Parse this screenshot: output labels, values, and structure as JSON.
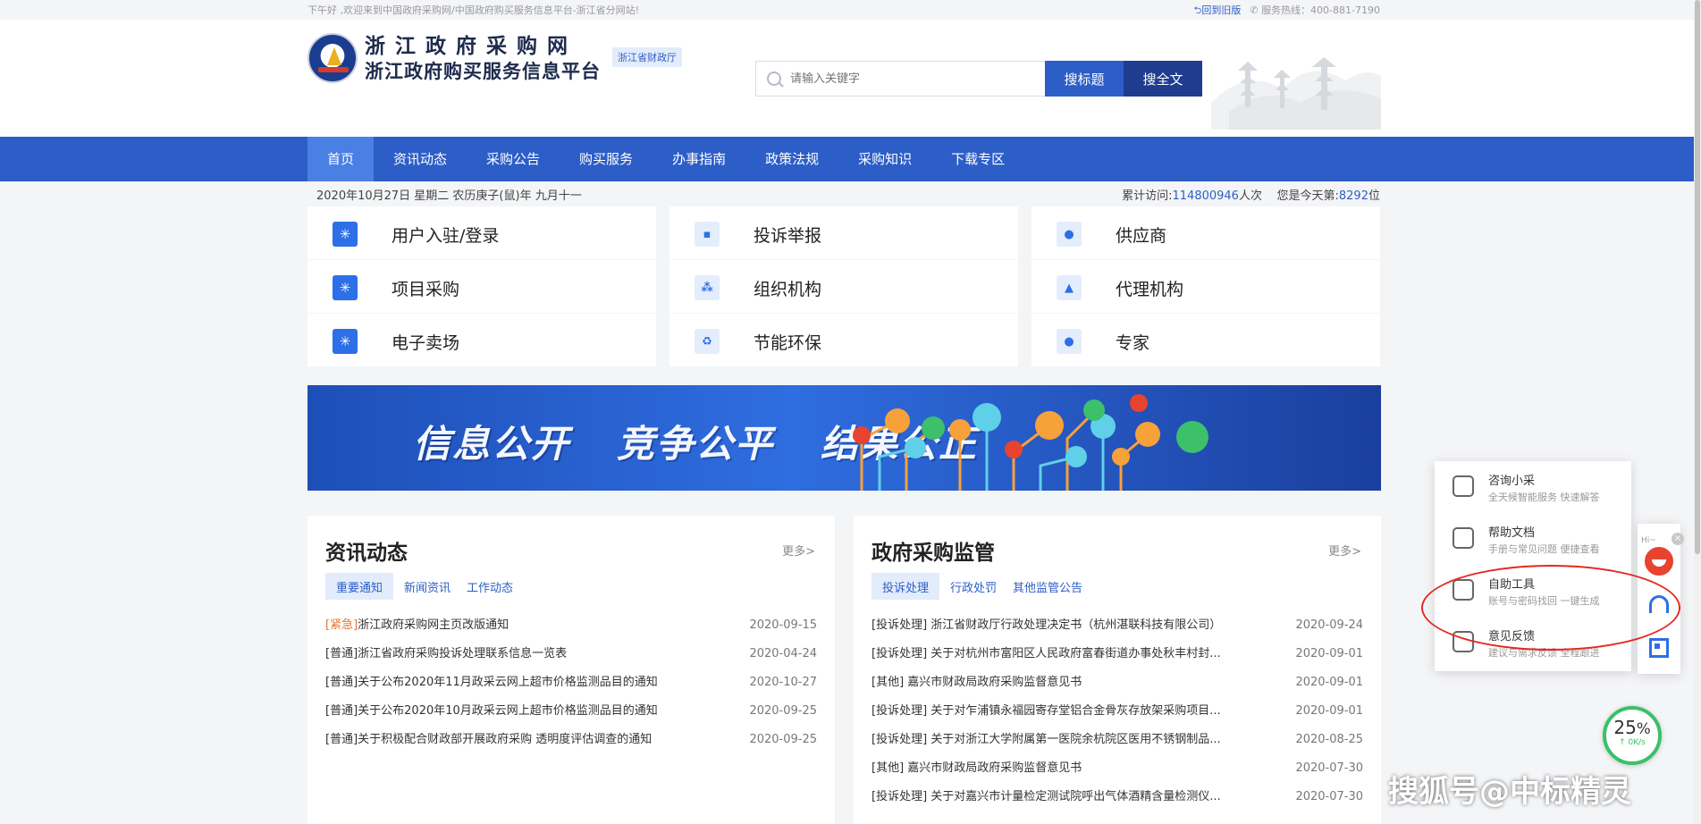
{
  "topbar": {
    "welcome": "下午好 ,欢迎来到中国政府采购网/中国政府购买服务信息平台-浙江省分网站!",
    "back_old": "回到旧版",
    "hotline": "服务热线：400-881-7190"
  },
  "header": {
    "title": "浙江政府采购网",
    "subtitle": "浙江政府购买服务信息平台",
    "dept_badge": "浙江省财政厅",
    "search_placeholder": "请输入关键字",
    "btn_search_title": "搜标题",
    "btn_search_full": "搜全文"
  },
  "nav": {
    "items": [
      {
        "label": "首页",
        "active": true
      },
      {
        "label": "资讯动态"
      },
      {
        "label": "采购公告"
      },
      {
        "label": "购买服务"
      },
      {
        "label": "办事指南"
      },
      {
        "label": "政策法规"
      },
      {
        "label": "采购知识"
      },
      {
        "label": "下载专区"
      }
    ]
  },
  "datebar": {
    "date": "2020年10月27日 星期二 农历庚子(鼠)年 九月十一",
    "visits_prefix": "累计访问:",
    "visits_count": "114800946",
    "visits_suffix": "人次",
    "today_prefix": "您是今天第:",
    "today_count": "8292",
    "today_suffix": "位"
  },
  "quick_links": [
    {
      "label": "用户入驻/登录",
      "icon": "snowflake-icon",
      "glyph": "✳"
    },
    {
      "label": "投诉举报",
      "icon": "chat-icon",
      "glyph": "▪"
    },
    {
      "label": "供应商",
      "icon": "user-icon",
      "glyph": "●"
    },
    {
      "label": "项目采购",
      "icon": "snowflake-icon",
      "glyph": "✳"
    },
    {
      "label": "组织机构",
      "icon": "org-chart-icon",
      "glyph": "⁂"
    },
    {
      "label": "代理机构",
      "icon": "building-icon",
      "glyph": "▲"
    },
    {
      "label": "电子卖场",
      "icon": "snowflake-icon",
      "glyph": "✳"
    },
    {
      "label": "节能环保",
      "icon": "recycle-icon",
      "glyph": "♻"
    },
    {
      "label": "专家",
      "icon": "experts-icon",
      "glyph": "●"
    }
  ],
  "banner": {
    "slogans": [
      "信息公开",
      "竞争公平",
      "结果公正"
    ]
  },
  "news_panel": {
    "title": "资讯动态",
    "more": "更多>",
    "tabs": [
      "重要通知",
      "新闻资讯",
      "工作动态"
    ],
    "items": [
      {
        "tag": "[紧急]",
        "title": "浙江政府采购网主页改版通知",
        "date": "2020-09-15",
        "urgent": true
      },
      {
        "tag": "[普通]",
        "title": "浙江省政府采购投诉处理联系信息一览表",
        "date": "2020-04-24"
      },
      {
        "tag": "[普通]",
        "title": "关于公布2020年11月政采云网上超市价格监测品目的通知",
        "date": "2020-10-27"
      },
      {
        "tag": "[普通]",
        "title": "关于公布2020年10月政采云网上超市价格监测品目的通知",
        "date": "2020-09-25"
      },
      {
        "tag": "[普通]",
        "title": "关于积极配合财政部开展政府采购 透明度评估调查的通知",
        "date": "2020-09-25"
      }
    ]
  },
  "supervision_panel": {
    "title": "政府采购监管",
    "more": "更多>",
    "tabs": [
      "投诉处理",
      "行政处罚",
      "其他监管公告"
    ],
    "items": [
      {
        "title": "[投诉处理] 浙江省财政厅行政处理决定书（杭州湛联科技有限公司）",
        "date": "2020-09-24"
      },
      {
        "title": "[投诉处理] 关于对杭州市富阳区人民政府富春街道办事处秋丰村封...",
        "date": "2020-09-01"
      },
      {
        "title": "[其他] 嘉兴市财政局政府采购监督意见书",
        "date": "2020-09-01"
      },
      {
        "title": "[投诉处理] 关于对乍浦镇永福园寄存堂铝合金骨灰存放架采购项目...",
        "date": "2020-09-01"
      },
      {
        "title": "[投诉处理] 关于对浙江大学附属第一医院余杭院区医用不锈钢制品...",
        "date": "2020-08-25"
      },
      {
        "title": "[其他] 嘉兴市财政局政府采购监督意见书",
        "date": "2020-07-30"
      },
      {
        "title": "[投诉处理] 关于对嘉兴市计量检定测试院呼出气体酒精含量检测仪...",
        "date": "2020-07-30"
      }
    ]
  },
  "service_widget": {
    "items": [
      {
        "title": "咨询小采",
        "desc": "全天候智能服务 快速解答",
        "icon": "chat-bot-icon"
      },
      {
        "title": "帮助文档",
        "desc": "手册与常见问题 便捷查看",
        "icon": "folder-icon"
      },
      {
        "title": "自助工具",
        "desc": "账号与密码找回 一键生成",
        "icon": "cube-icon"
      },
      {
        "title": "意见反馈",
        "desc": "建议与需求反馈 全程跟进",
        "icon": "pen-icon"
      }
    ],
    "greeting": "Hi~",
    "close": "×"
  },
  "speed_meter": {
    "percent": "25",
    "percent_unit": "%",
    "rate": "↑ 0K/s"
  },
  "watermark": "搜狐号@中标精灵",
  "colors": {
    "primary": "#2d5ec7",
    "nav_active": "#4a7fe3",
    "urgent": "#e8742b",
    "annotation": "#e32a20"
  }
}
